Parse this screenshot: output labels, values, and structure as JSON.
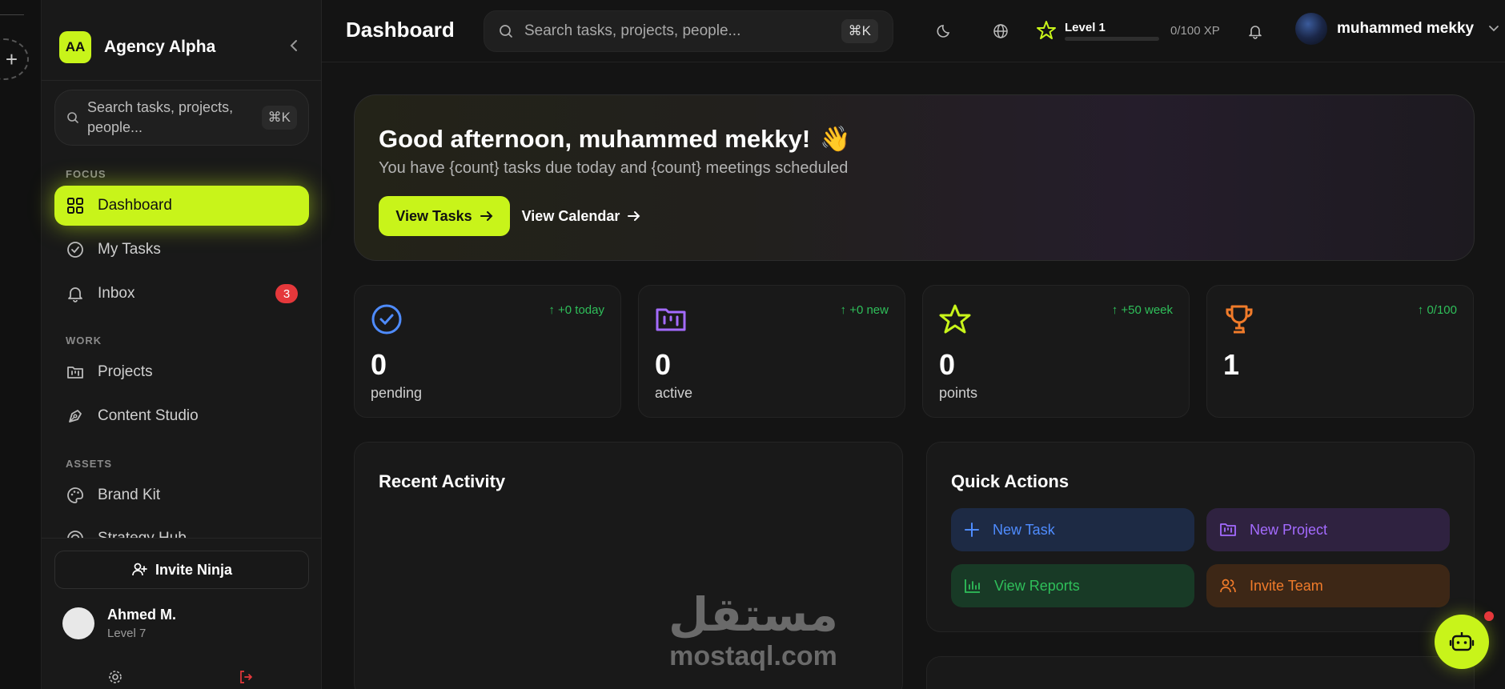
{
  "brand": {
    "initials": "AA",
    "name": "Agency Alpha"
  },
  "sidebar": {
    "search_text": "Search tasks, projects, people...",
    "search_kbd": "⌘K",
    "sections": {
      "focus": "FOCUS",
      "work": "WORK",
      "assets": "ASSETS"
    },
    "items": {
      "dashboard": "Dashboard",
      "my_tasks": "My Tasks",
      "inbox": "Inbox",
      "inbox_badge": "3",
      "projects": "Projects",
      "content_studio": "Content Studio",
      "brand_kit": "Brand Kit",
      "strategy_hub": "Strategy Hub"
    },
    "invite_label": "Invite Ninja",
    "user": {
      "name": "Ahmed M.",
      "level": "Level 7"
    }
  },
  "header": {
    "title": "Dashboard",
    "search_placeholder": "Search tasks, projects, people...",
    "search_kbd": "⌘K",
    "level_label": "Level 1",
    "xp_text": "0/100 XP",
    "xp_progress": 0,
    "user_name": "muhammed mekky"
  },
  "hero": {
    "greeting": "Good afternoon, muhammed mekky!",
    "emoji": "👋",
    "subtitle": "You have {count} tasks due today and {count} meetings scheduled",
    "primary_btn": "View Tasks",
    "secondary_btn": "View Calendar"
  },
  "stats": [
    {
      "value": "0",
      "caption": "pending",
      "delta": "↑ +0 today",
      "color": "#4f8cff"
    },
    {
      "value": "0",
      "caption": "active",
      "delta": "↑ +0 new",
      "color": "#a46bff"
    },
    {
      "value": "0",
      "caption": "points",
      "delta": "↑ +50 week",
      "color": "#c8f41a"
    },
    {
      "value": "1",
      "caption": "",
      "delta": "↑ 0/100",
      "color": "#f07b2a"
    }
  ],
  "recent_activity": {
    "title": "Recent Activity"
  },
  "quick_actions": {
    "title": "Quick Actions",
    "new_task": "New Task",
    "new_project": "New Project",
    "view_reports": "View Reports",
    "invite_team": "Invite Team"
  },
  "watermark": {
    "arabic": "مستقل",
    "latin": "mostaql.com"
  },
  "colors": {
    "accent": "#c8f41a",
    "background": "#141414",
    "danger": "#e5383b"
  }
}
